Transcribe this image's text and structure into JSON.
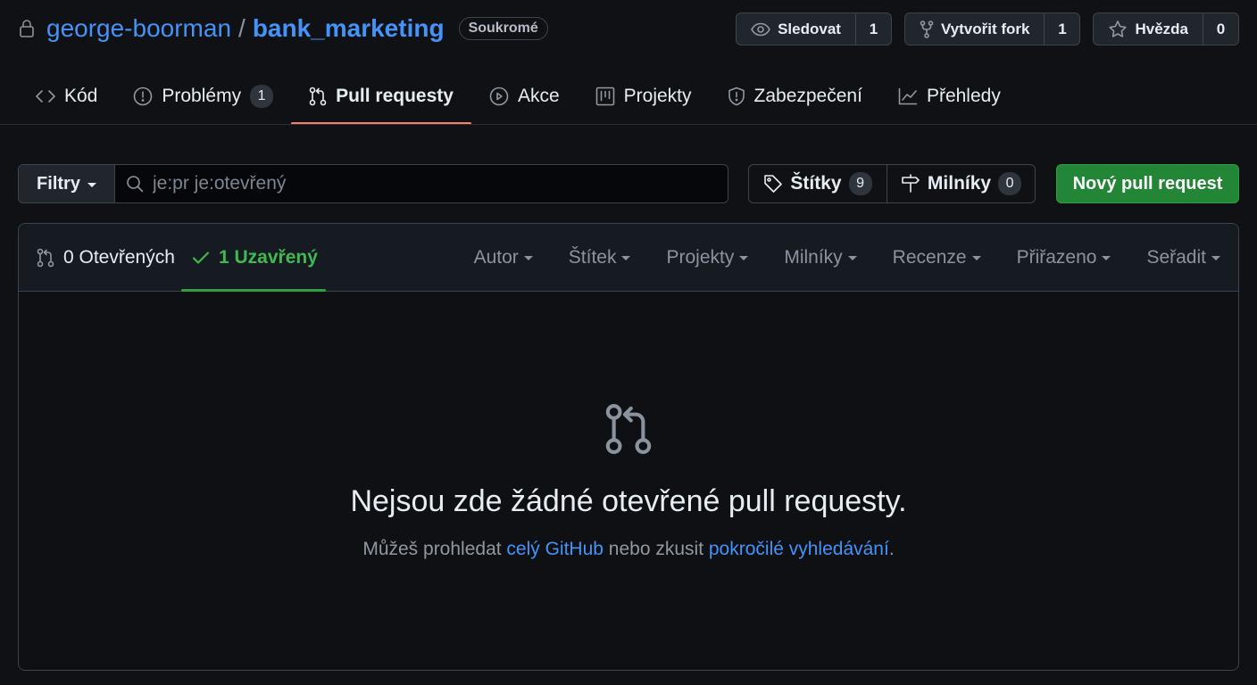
{
  "repo": {
    "owner": "george-boorman",
    "separator": "/",
    "name": "bank_marketing",
    "visibility": "Soukromé"
  },
  "actions": {
    "watch": {
      "label": "Sledovat",
      "count": "1"
    },
    "fork": {
      "label": "Vytvořit fork",
      "count": "1"
    },
    "star": {
      "label": "Hvězda",
      "count": "0"
    }
  },
  "tabs": [
    {
      "label": "Kód",
      "icon": "code-icon"
    },
    {
      "label": "Problémy",
      "icon": "issue-icon",
      "counter": "1"
    },
    {
      "label": "Pull requesty",
      "icon": "pull-request-icon",
      "active": true
    },
    {
      "label": "Akce",
      "icon": "play-icon"
    },
    {
      "label": "Projekty",
      "icon": "project-icon"
    },
    {
      "label": "Zabezpečení",
      "icon": "shield-icon"
    },
    {
      "label": "Přehledy",
      "icon": "graph-icon"
    }
  ],
  "filter": {
    "button_label": "Filtry",
    "search_value": "je:pr je:otevřený"
  },
  "labels": {
    "label": "Štítky",
    "count": "9"
  },
  "milestones": {
    "label": "Milníky",
    "count": "0"
  },
  "new_pr_label": "Nový pull request",
  "states": {
    "open": "0 Otevřených",
    "closed": "1 Uzavřený"
  },
  "sort_menus": [
    "Autor",
    "Štítek",
    "Projekty",
    "Milníky",
    "Recenze",
    "Přiřazeno",
    "Seřadit"
  ],
  "blankslate": {
    "title": "Nejsou zde žádné otevřené pull requesty.",
    "text_before": "Můžeš prohledat ",
    "link1": "celý GitHub",
    "text_middle": " nebo zkusit ",
    "link2": "pokročilé vyhledávání",
    "text_after": "."
  },
  "colors": {
    "background": "#0f1115",
    "link": "#4493f8",
    "primary_button": "#238636",
    "active_tab_underline": "#f78166",
    "closed_state": "#3fb950"
  }
}
